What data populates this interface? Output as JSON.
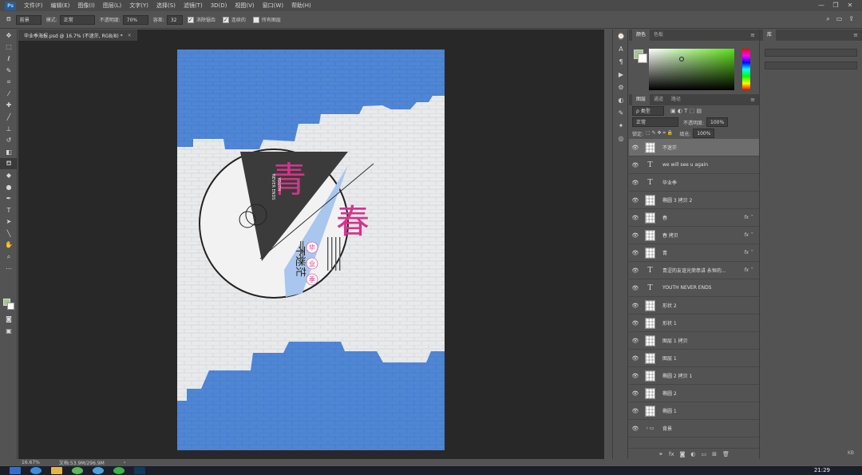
{
  "menubar": {
    "logo": "Ps",
    "items": [
      "文件(F)",
      "编辑(E)",
      "图像(I)",
      "图层(L)",
      "文字(Y)",
      "选择(S)",
      "滤镜(T)",
      "3D(D)",
      "视图(V)",
      "窗口(W)",
      "帮助(H)"
    ],
    "window_controls": [
      "—",
      "❐",
      "✕"
    ]
  },
  "options": {
    "preset_value": "前景",
    "mode_label": "模式:",
    "mode_value": "正常",
    "opacity_label": "不透明度:",
    "opacity_value": "70%",
    "tolerance_label": "容差:",
    "tolerance_value": "32",
    "antialias_label": "消除锯齿",
    "antialias_checked": true,
    "contiguous_label": "连续的",
    "contiguous_checked": true,
    "all_layers_label": "所有图层",
    "all_layers_checked": false
  },
  "document": {
    "tab_title": "毕业季海报.psd @ 16.7% (不迷茫, RGB/8) *",
    "close": "×"
  },
  "poster": {
    "char_qing": "青",
    "char_chun": "春",
    "youth": "YOUTH",
    "never_ends": "NEVER ENDS",
    "bumimang": "不迷茫",
    "biye": "毕",
    "ye": "业",
    "ji": "季",
    "colors": {
      "blue": "#4f86d6",
      "wall": "#e9eaec",
      "dark": "#3b3b3b",
      "pink": "#d2358a",
      "lightblue": "#a9c6ee"
    }
  },
  "status": {
    "zoom": "16.67%",
    "doc": "文档:53.9M/296.9M"
  },
  "color_panel": {
    "tabs": [
      "颜色",
      "色板"
    ],
    "active": 0,
    "fg": "#a4c68e"
  },
  "layers_panel": {
    "tabs": [
      "图层",
      "通道",
      "路径"
    ],
    "active": 0,
    "filter_label": "ρ 类型",
    "blend": "正常",
    "opacity_label": "不透明度:",
    "opacity": "100%",
    "lock_label": "锁定:",
    "fill_label": "填充:",
    "fill": "100%",
    "layers": [
      {
        "name": "不迷茫",
        "type": "pixel",
        "selected": true,
        "fx": false
      },
      {
        "name": "we will see u again",
        "type": "text",
        "selected": false,
        "fx": false
      },
      {
        "name": "毕业季",
        "type": "text",
        "selected": false,
        "fx": false
      },
      {
        "name": "椭圆 3 拷贝 2",
        "type": "pixel",
        "selected": false,
        "fx": false
      },
      {
        "name": "春",
        "type": "pixel",
        "selected": false,
        "fx": true
      },
      {
        "name": "春 拷贝",
        "type": "pixel",
        "selected": false,
        "fx": true
      },
      {
        "name": "青",
        "type": "pixel",
        "selected": false,
        "fx": true
      },
      {
        "name": "青涩的友谊光荣串讲 永恒的...",
        "type": "text",
        "selected": false,
        "fx": true
      },
      {
        "name": "YOUTH NEVER ENDS",
        "type": "text",
        "selected": false,
        "fx": false
      },
      {
        "name": "形状 2",
        "type": "pixel",
        "selected": false,
        "fx": false
      },
      {
        "name": "形状 1",
        "type": "pixel",
        "selected": false,
        "fx": false
      },
      {
        "name": "图层 1 拷贝",
        "type": "pixel",
        "selected": false,
        "fx": false
      },
      {
        "name": "图层 1",
        "type": "pixel",
        "selected": false,
        "fx": false
      },
      {
        "name": "椭圆 2 拷贝 1",
        "type": "pixel",
        "selected": false,
        "fx": false
      },
      {
        "name": "椭圆 2",
        "type": "pixel",
        "selected": false,
        "fx": false
      },
      {
        "name": "椭圆 1",
        "type": "pixel",
        "selected": false,
        "fx": false
      },
      {
        "name": "背景",
        "type": "group",
        "selected": false,
        "fx": false
      }
    ]
  },
  "library_panel": {
    "tab": "库",
    "size": "KB"
  },
  "taskbar": {
    "time": "21:29"
  }
}
